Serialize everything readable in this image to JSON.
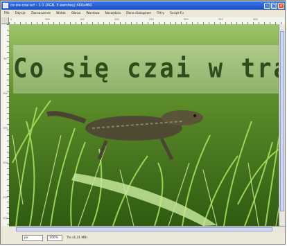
{
  "window": {
    "title": "co-sie-czai.w.f – 1:1 (RGB, 3 warstwy) 466x460",
    "controls": {
      "minimize": "–",
      "maximize": "□",
      "close": "×"
    }
  },
  "menu": [
    {
      "label": "Plik"
    },
    {
      "label": "Edycja"
    },
    {
      "label": "Zaznaczenie"
    },
    {
      "label": "Widok"
    },
    {
      "label": "Obraz"
    },
    {
      "label": "Warstwa"
    },
    {
      "label": "Narzędzia"
    },
    {
      "label": "Okna dialogowe"
    },
    {
      "label": "Filtry"
    },
    {
      "label": "Script-Fu"
    }
  ],
  "ruler": {
    "top": [
      "0",
      "100",
      "150",
      "200",
      "250",
      "300",
      "350",
      "400"
    ],
    "left": [
      "50",
      "100",
      "150",
      "200",
      "250",
      "300"
    ]
  },
  "image": {
    "caption": "Co się czai w trawie?",
    "colors": {
      "grass_dark": "#2a4a12",
      "grass_light": "#7fc23a",
      "caption": "#2f4d1c"
    }
  },
  "status": {
    "unit": "px",
    "zoom": "100%",
    "info": "Tło (4,31 MB)"
  }
}
